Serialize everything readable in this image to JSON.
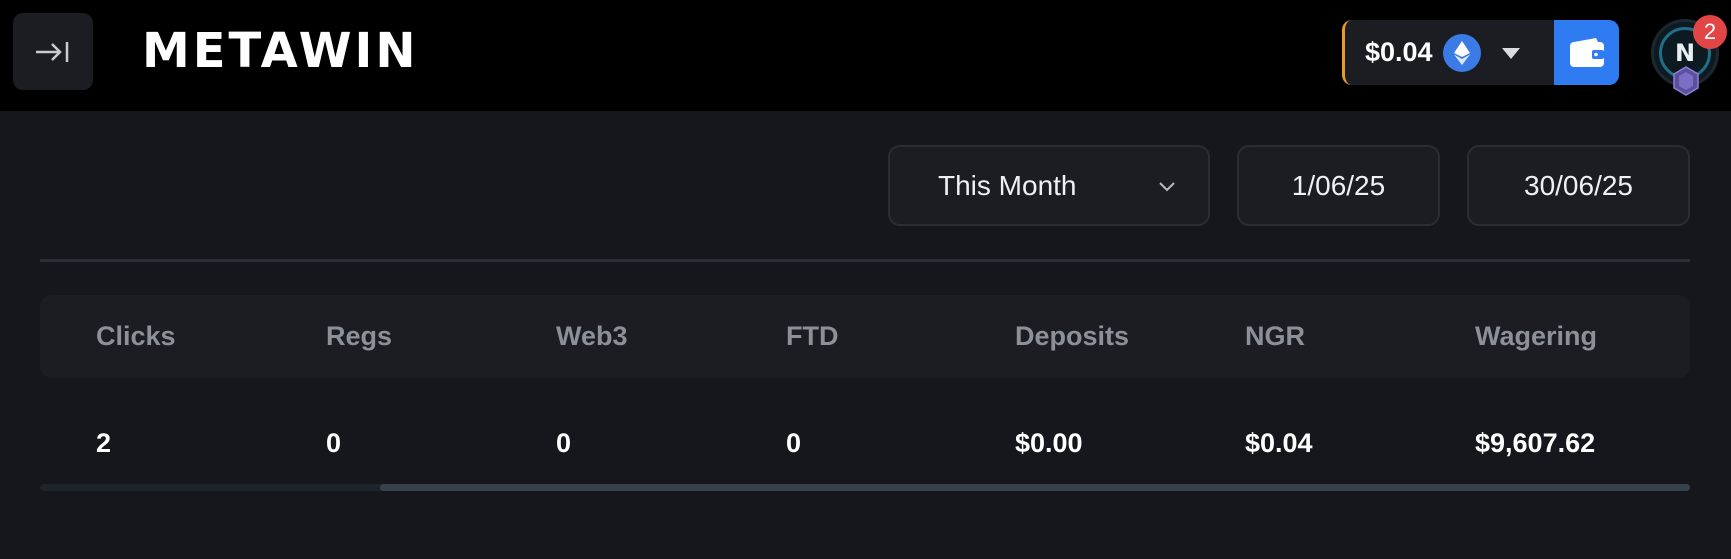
{
  "header": {
    "logo_text": "METAWIN",
    "balance": "$0.04",
    "currency_icon": "ethereum-icon",
    "notification_count": "2",
    "accent_color": "#2f7bf2",
    "balance_border_color": "#e89a2c"
  },
  "filters": {
    "period": "This Month",
    "date_start": "1/06/25",
    "date_end": "30/06/25"
  },
  "table": {
    "columns": [
      "Clicks",
      "Regs",
      "Web3",
      "FTD",
      "Deposits",
      "NGR",
      "Wagering"
    ],
    "rows": [
      [
        "2",
        "0",
        "0",
        "0",
        "$0.00",
        "$0.04",
        "$9,607.62"
      ]
    ]
  }
}
